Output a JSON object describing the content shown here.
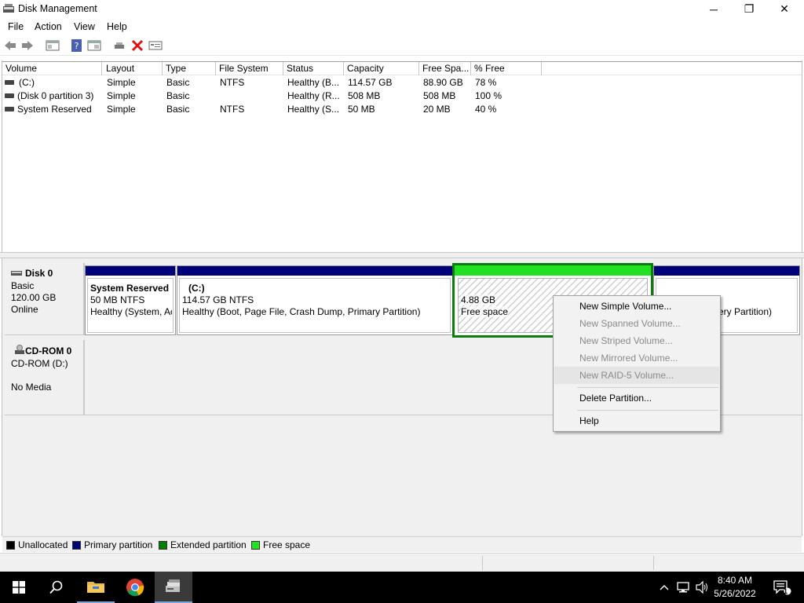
{
  "window": {
    "title": "Disk Management",
    "controls": {
      "minimize": "─",
      "maximize": "❐",
      "close": "✕"
    }
  },
  "menu": [
    "File",
    "Action",
    "View",
    "Help"
  ],
  "toolbar_icons": [
    "back-icon",
    "forward-icon",
    "console-tree-icon",
    "help-icon",
    "properties-icon",
    "connect-icon",
    "delete-icon",
    "settings-icon"
  ],
  "volume_list": {
    "columns": [
      "Volume",
      "Layout",
      "Type",
      "File System",
      "Status",
      "Capacity",
      "Free Spa...",
      "% Free"
    ],
    "rows": [
      [
        "(C:)",
        "Simple",
        "Basic",
        "NTFS",
        "Healthy (B...",
        "114.57 GB",
        "88.90 GB",
        "78 %"
      ],
      [
        "(Disk 0 partition 3)",
        "Simple",
        "Basic",
        "",
        "Healthy (R...",
        "508 MB",
        "508 MB",
        "100 %"
      ],
      [
        "System Reserved",
        "Simple",
        "Basic",
        "NTFS",
        "Healthy (S...",
        "50 MB",
        "20 MB",
        "40 %"
      ]
    ]
  },
  "disks": {
    "disk0": {
      "name": "Disk 0",
      "type": "Basic",
      "size": "120.00 GB",
      "state": "Online",
      "partitions": {
        "reserved": {
          "title": "System Reserved",
          "size": "50 MB NTFS",
          "status": "Healthy (System, Ac"
        },
        "c": {
          "title": "(C:)",
          "size": "114.57 GB NTFS",
          "status": "Healthy (Boot, Page File, Crash Dump, Primary Partition)"
        },
        "free": {
          "size": "4.88 GB",
          "label": "Free space"
        },
        "recovery": {
          "status": "ery Partition)"
        }
      }
    },
    "cdrom0": {
      "name": "CD-ROM 0",
      "type": "CD-ROM (D:)",
      "media": "No Media"
    }
  },
  "legend": [
    {
      "label": "Unallocated",
      "color": "#000000"
    },
    {
      "label": "Primary partition",
      "color": "#00007a"
    },
    {
      "label": "Extended partition",
      "color": "#008000"
    },
    {
      "label": "Free space",
      "color": "#22e022"
    }
  ],
  "context_menu": {
    "items": [
      {
        "label": "New Simple Volume...",
        "enabled": true
      },
      {
        "label": "New Spanned Volume...",
        "enabled": false
      },
      {
        "label": "New Striped Volume...",
        "enabled": false
      },
      {
        "label": "New Mirrored Volume...",
        "enabled": false
      },
      {
        "label": "New RAID-5 Volume...",
        "enabled": false
      },
      {
        "label": "Delete Partition...",
        "enabled": true
      },
      {
        "label": "Help",
        "enabled": true
      }
    ]
  },
  "taskbar": {
    "apps": [
      "start-icon",
      "search-icon",
      "file-explorer-icon",
      "chrome-icon",
      "disk-management-icon"
    ],
    "time": "8:40 AM",
    "date": "5/26/2022",
    "notification_count": "1"
  },
  "colors": {
    "primary_partition": "#00007a",
    "extended_partition": "#008000",
    "free_space": "#22e022"
  }
}
